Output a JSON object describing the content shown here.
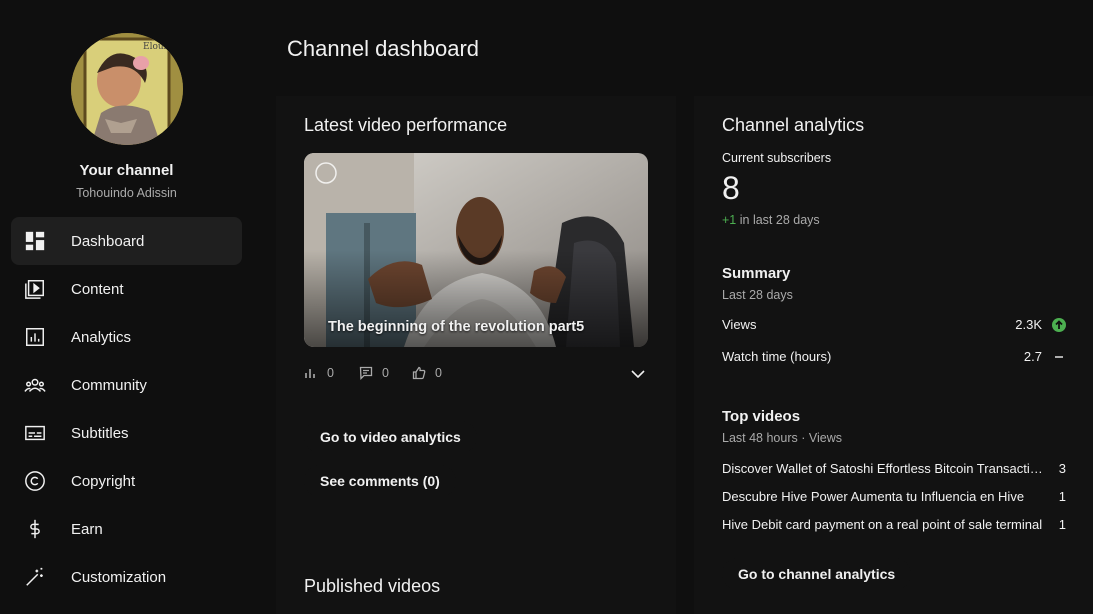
{
  "sidebar": {
    "channel_title": "Your channel",
    "channel_name": "Tohouindo Adissin",
    "items": [
      {
        "label": "Dashboard",
        "icon": "dashboard-icon",
        "active": true
      },
      {
        "label": "Content",
        "icon": "content-icon"
      },
      {
        "label": "Analytics",
        "icon": "analytics-icon"
      },
      {
        "label": "Community",
        "icon": "community-icon"
      },
      {
        "label": "Subtitles",
        "icon": "subtitles-icon"
      },
      {
        "label": "Copyright",
        "icon": "copyright-icon"
      },
      {
        "label": "Earn",
        "icon": "dollar-icon"
      },
      {
        "label": "Customization",
        "icon": "magic-wand-icon"
      }
    ]
  },
  "main": {
    "page_title": "Channel dashboard",
    "latest": {
      "title": "Latest video performance",
      "video_title": "The beginning of the revolution part5",
      "views": "0",
      "comments": "0",
      "likes": "0",
      "go_video_analytics": "Go to video analytics",
      "see_comments": "See comments (0)"
    },
    "published_title": "Published videos",
    "analytics": {
      "title": "Channel analytics",
      "subs_label": "Current subscribers",
      "subs_value": "8",
      "subs_delta": "+1",
      "subs_delta_suffix": "in last 28 days",
      "summary_title": "Summary",
      "summary_period": "Last 28 days",
      "rows": [
        {
          "label": "Views",
          "value": "2.3K",
          "indicator": "up-arrow-icon"
        },
        {
          "label": "Watch time (hours)",
          "value": "2.7",
          "indicator": "dash-icon"
        }
      ],
      "top_title": "Top videos",
      "top_period": "Last 48 hours · Views",
      "top_videos": [
        {
          "title": "Discover Wallet of Satoshi Effortless Bitcoin Transactions",
          "views": "3"
        },
        {
          "title": "Descubre Hive Power Aumenta tu Influencia en Hive",
          "views": "1"
        },
        {
          "title": "Hive Debit card payment on a real point of sale terminal",
          "views": "1"
        }
      ],
      "go_channel_analytics": "Go to channel analytics"
    }
  },
  "colors": {
    "background": "#0f0f0f",
    "panel": "#121212",
    "active_nav": "#1f1f1f",
    "muted_text": "#aaaaaa",
    "positive": "#4caf50"
  }
}
